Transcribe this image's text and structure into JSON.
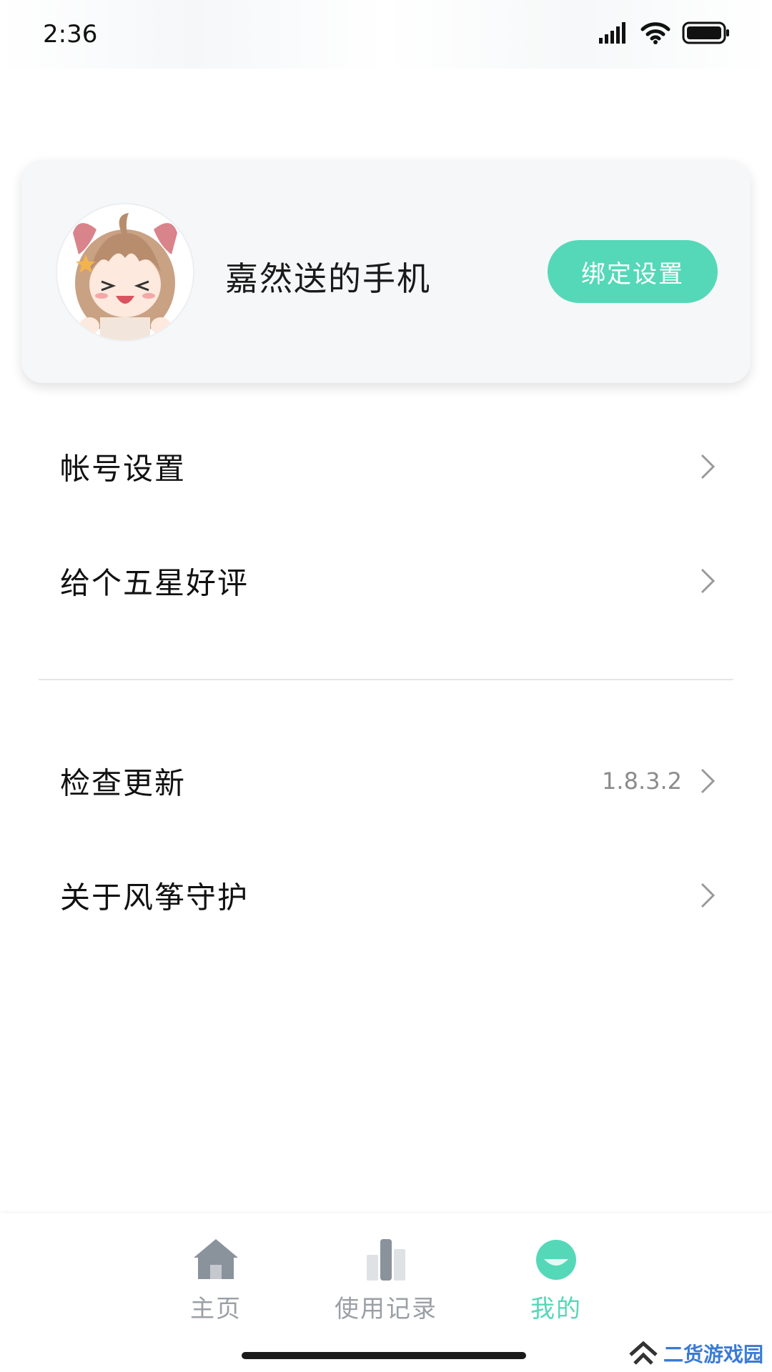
{
  "status_bar": {
    "time": "2:36"
  },
  "profile": {
    "device_name": "嘉然送的手机",
    "bind_button_label": "绑定设置"
  },
  "menu": {
    "account_settings": "帐号设置",
    "five_star_review": "给个五星好评",
    "check_update": "检查更新",
    "check_update_version": "1.8.3.2",
    "about": "关于风筝守护"
  },
  "bottom_nav": {
    "items": [
      {
        "label": "主页",
        "icon": "home-icon",
        "active": false
      },
      {
        "label": "使用记录",
        "icon": "usage-chart-icon",
        "active": false
      },
      {
        "label": "我的",
        "icon": "profile-icon",
        "active": true
      }
    ]
  },
  "watermark": {
    "text": "二货游戏园"
  },
  "colors": {
    "accent": "#55d8b8",
    "inactive_nav": "#9aa0a6",
    "card_bg": "#f6f7f9"
  }
}
